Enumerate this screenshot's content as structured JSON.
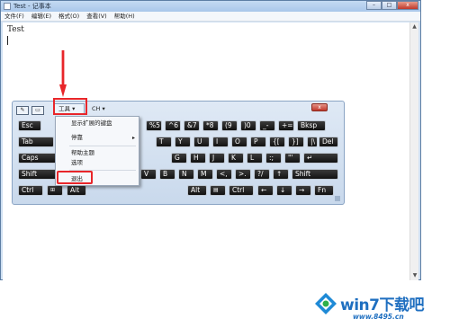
{
  "window": {
    "title": "Test - 记事本",
    "buttons": {
      "minimize": "–",
      "maximize": "□",
      "close": "x"
    }
  },
  "menubar": [
    {
      "label": "文件(F)"
    },
    {
      "label": "编辑(E)"
    },
    {
      "label": "格式(O)"
    },
    {
      "label": "查看(V)"
    },
    {
      "label": "帮助(H)"
    }
  ],
  "editor": {
    "text": "Test"
  },
  "scrollbar": {
    "up": "▲",
    "down": "▼"
  },
  "osk": {
    "tools_label": "工具 ▾",
    "lang_label": "CH ▾",
    "close_label": "x",
    "keys": {
      "esc": "Esc",
      "p5": "%5",
      "c6": "^6",
      "a7": "&7",
      "s8": "*8",
      "p9": "(9",
      "p0": ")0",
      "dash": "_-",
      "plus": "+=",
      "bksp": "Bksp",
      "tab": "Tab",
      "t": "T",
      "y": "Y",
      "u": "U",
      "i": "I",
      "o": "O",
      "p": "P",
      "lb": "{[",
      "rb": "}]",
      "pipe": "|\\",
      "del": "Del",
      "caps": "Caps",
      "g": "G",
      "h": "H",
      "j": "J",
      "k": "K",
      "l": "L",
      "semi": ":;",
      "quote": "\"'",
      "enter": "↵",
      "shift_l": "Shift",
      "v": "V",
      "b": "B",
      "n": "N",
      "m": "M",
      "lt": "<,",
      "gt": ">.",
      "q": "?/",
      "up": "↑",
      "shift_r": "Shift",
      "ctrl_l": "Ctrl",
      "win": "⊞",
      "alt_l": "Alt",
      "alt_r": "Alt",
      "menu": "▤",
      "ctrl_r": "Ctrl",
      "left": "←",
      "down": "↓",
      "right": "→",
      "fn": "Fn"
    }
  },
  "tools_menu": {
    "items": [
      {
        "label": "显示扩展的键盘"
      },
      {
        "label": "停靠"
      },
      {
        "label": "帮助主题"
      },
      {
        "label": "选项"
      },
      {
        "label": "退出"
      }
    ],
    "submenu_arrow": "▸"
  },
  "watermark": {
    "title": "win7下载吧",
    "url": "www.8495.cn"
  },
  "colors": {
    "highlight": "#e8262a",
    "brand": "#1f6fc0"
  }
}
